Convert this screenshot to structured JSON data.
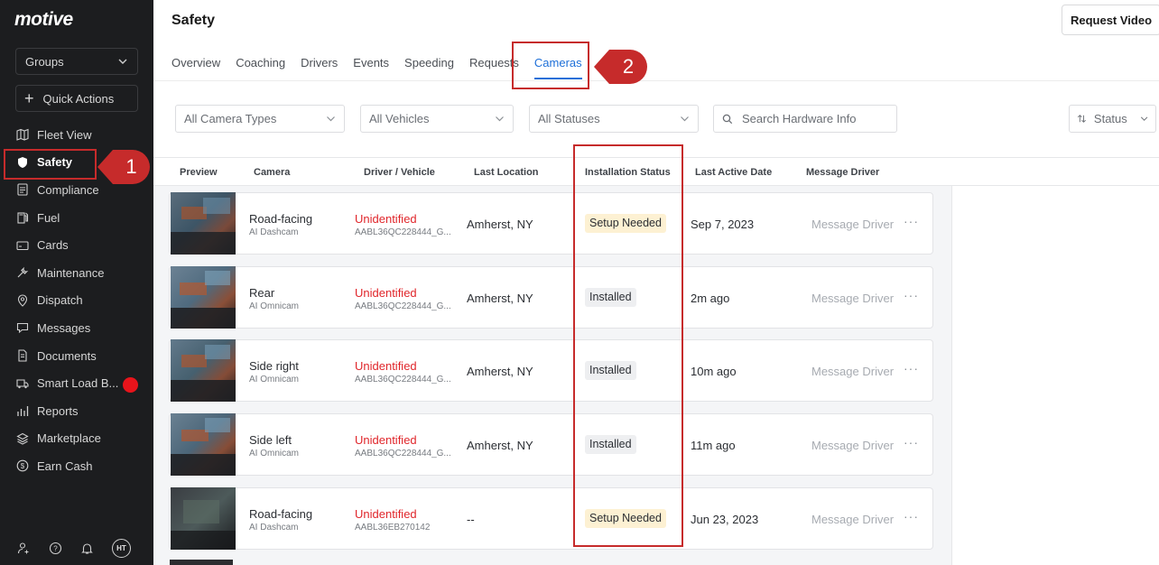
{
  "brand": {
    "logo": "motive"
  },
  "sidebar": {
    "groups_label": "Groups",
    "quick_actions_label": "Quick Actions",
    "items": [
      {
        "label": "Fleet View",
        "icon": "map-icon"
      },
      {
        "label": "Safety",
        "icon": "shield-icon"
      },
      {
        "label": "Compliance",
        "icon": "document-icon"
      },
      {
        "label": "Fuel",
        "icon": "fuel-icon"
      },
      {
        "label": "Cards",
        "icon": "card-icon"
      },
      {
        "label": "Maintenance",
        "icon": "wrench-icon"
      },
      {
        "label": "Dispatch",
        "icon": "location-pin-icon"
      },
      {
        "label": "Messages",
        "icon": "chat-icon"
      },
      {
        "label": "Documents",
        "icon": "file-icon"
      },
      {
        "label": "Smart Load B...",
        "icon": "truck-icon"
      },
      {
        "label": "Reports",
        "icon": "chart-icon"
      },
      {
        "label": "Marketplace",
        "icon": "layers-icon"
      },
      {
        "label": "Earn Cash",
        "icon": "dollar-icon"
      }
    ],
    "avatar_initials": "HT"
  },
  "header": {
    "title": "Safety",
    "request_video_label": "Request Video"
  },
  "tabs": [
    "Overview",
    "Coaching",
    "Drivers",
    "Events",
    "Speeding",
    "Requests",
    "Cameras"
  ],
  "active_tab": "Cameras",
  "filters": {
    "camera_types": "All Camera Types",
    "vehicles": "All Vehicles",
    "statuses": "All Statuses",
    "search_placeholder": "Search Hardware Info",
    "sort_label": "Status"
  },
  "table": {
    "headers": [
      "Preview",
      "Camera",
      "Driver / Vehicle",
      "Last Location",
      "Installation Status",
      "Last Active Date",
      "Message Driver"
    ],
    "rows": [
      {
        "camera": "Road-facing",
        "camera_type": "AI Dashcam",
        "driver": "Unidentified",
        "vehicle": "AABL36QC228444_G...",
        "location": "Amherst, NY",
        "status": "Setup Needed",
        "last_active": "Sep 7, 2023",
        "message": "Message Driver",
        "more": "···"
      },
      {
        "camera": "Rear",
        "camera_type": "AI Omnicam",
        "driver": "Unidentified",
        "vehicle": "AABL36QC228444_G...",
        "location": "Amherst, NY",
        "status": "Installed",
        "last_active": "2m ago",
        "message": "Message Driver",
        "more": "···"
      },
      {
        "camera": "Side right",
        "camera_type": "AI Omnicam",
        "driver": "Unidentified",
        "vehicle": "AABL36QC228444_G...",
        "location": "Amherst, NY",
        "status": "Installed",
        "last_active": "10m ago",
        "message": "Message Driver",
        "more": "···"
      },
      {
        "camera": "Side left",
        "camera_type": "AI Omnicam",
        "driver": "Unidentified",
        "vehicle": "AABL36QC228444_G...",
        "location": "Amherst, NY",
        "status": "Installed",
        "last_active": "11m ago",
        "message": "Message Driver",
        "more": "···"
      },
      {
        "camera": "Road-facing",
        "camera_type": "AI Dashcam",
        "driver": "Unidentified",
        "vehicle": "AABL36EB270142",
        "location": "--",
        "status": "Setup Needed",
        "last_active": "Jun 23, 2023",
        "message": "Message Driver",
        "more": "···"
      }
    ]
  },
  "annotations": {
    "callout_1": "1",
    "callout_2": "2"
  },
  "colors": {
    "accent": "#1d6fd8",
    "annotation_red": "#c62b2b",
    "unidentified_red": "#e0262b",
    "setup_badge": "#fdf1d3",
    "installed_badge": "#eeeff1",
    "sidebar_bg": "#1c1d1f"
  }
}
